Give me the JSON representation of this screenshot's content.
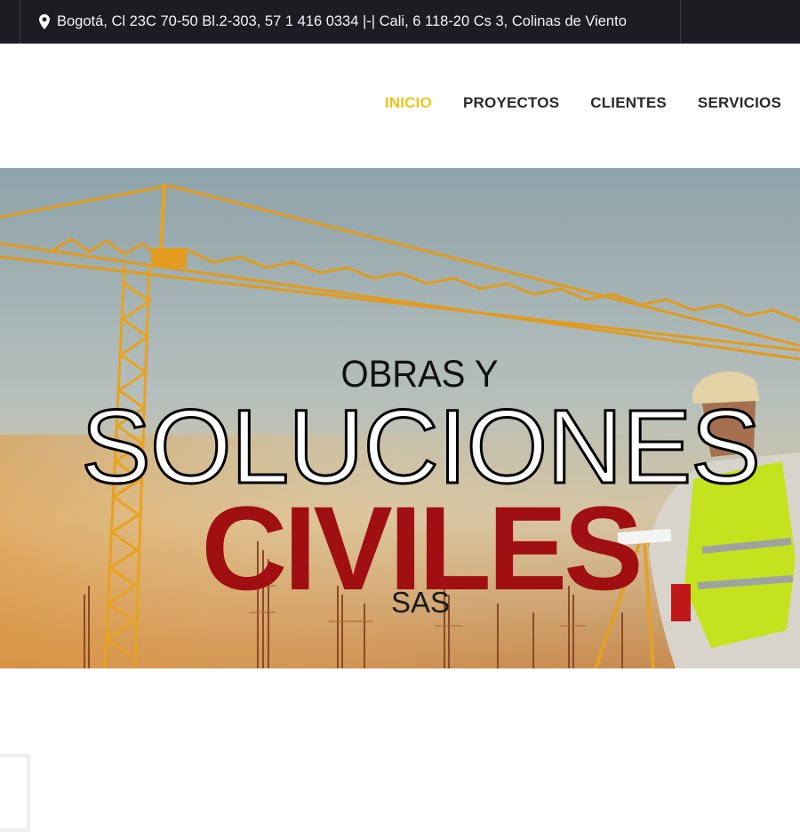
{
  "topbar": {
    "address": "Bogotá, Cl 23C 70-50 Bl.2-303, 57 1 416 0334 |-| Cali, 6 118-20 Cs 3, Colinas de Viento",
    "icon": "map-marker-icon"
  },
  "nav": {
    "items": [
      {
        "label": "INICIO",
        "active": true
      },
      {
        "label": "PROYECTOS",
        "active": false
      },
      {
        "label": "CLIENTES",
        "active": false
      },
      {
        "label": "SERVICIOS",
        "active": false
      }
    ],
    "active_color": "#f2c31b",
    "text_color": "#2a2a2a"
  },
  "hero": {
    "line1": "OBRAS Y",
    "line2": "SOLUCIONES",
    "line3": "CIVILES",
    "line4": "SAS",
    "accent_color": "#a00f12"
  }
}
